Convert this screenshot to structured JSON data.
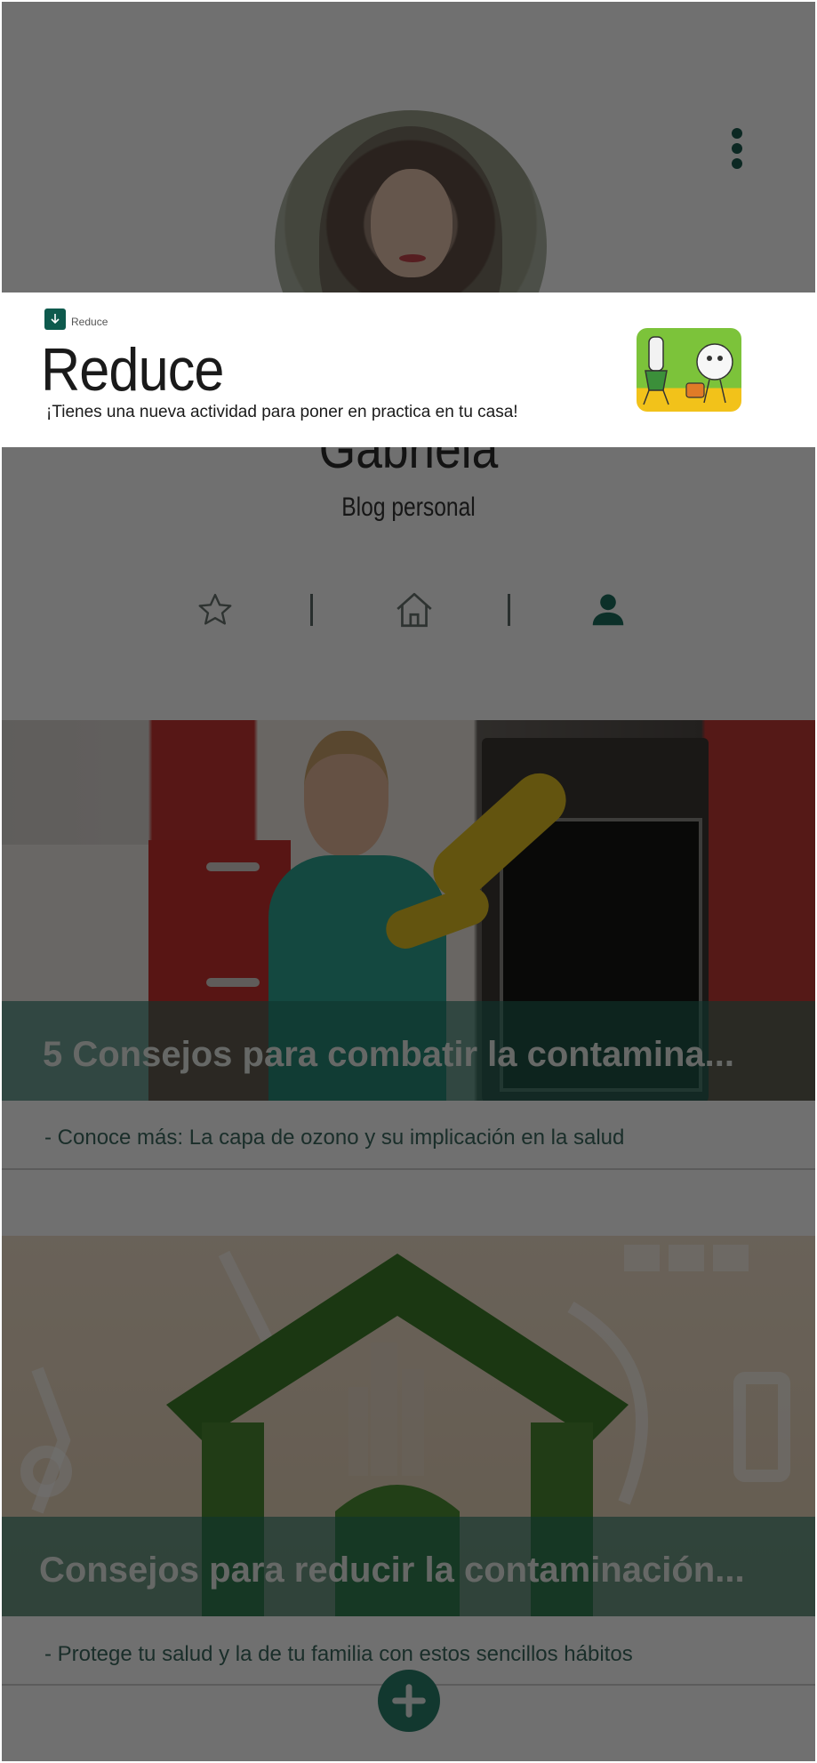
{
  "profile": {
    "name": "Gabriela",
    "subtitle": "Blog personal"
  },
  "tabs": [
    {
      "id": "favorites",
      "icon": "star-outline-icon",
      "active": false
    },
    {
      "id": "home",
      "icon": "home-outline-icon",
      "active": false
    },
    {
      "id": "profile",
      "icon": "person-icon",
      "active": true
    }
  ],
  "posts": [
    {
      "title": "5 Consejos para combatir la contamina...",
      "subtitle": "- Conoce más: La capa de ozono y su implicación en la salud"
    },
    {
      "title": "Consejos para reducir la contaminación...",
      "subtitle": "- Protege tu salud y la de tu familia con estos sencillos hábitos"
    }
  ],
  "notification": {
    "app_name": "Reduce",
    "title": "Reduce",
    "text": "¡Tienes una nueva actividad para poner en practica en tu casa!"
  },
  "colors": {
    "accent": "#2b7f6c",
    "title_bar": "#247866",
    "notification_icon": "#0e5a4d"
  }
}
